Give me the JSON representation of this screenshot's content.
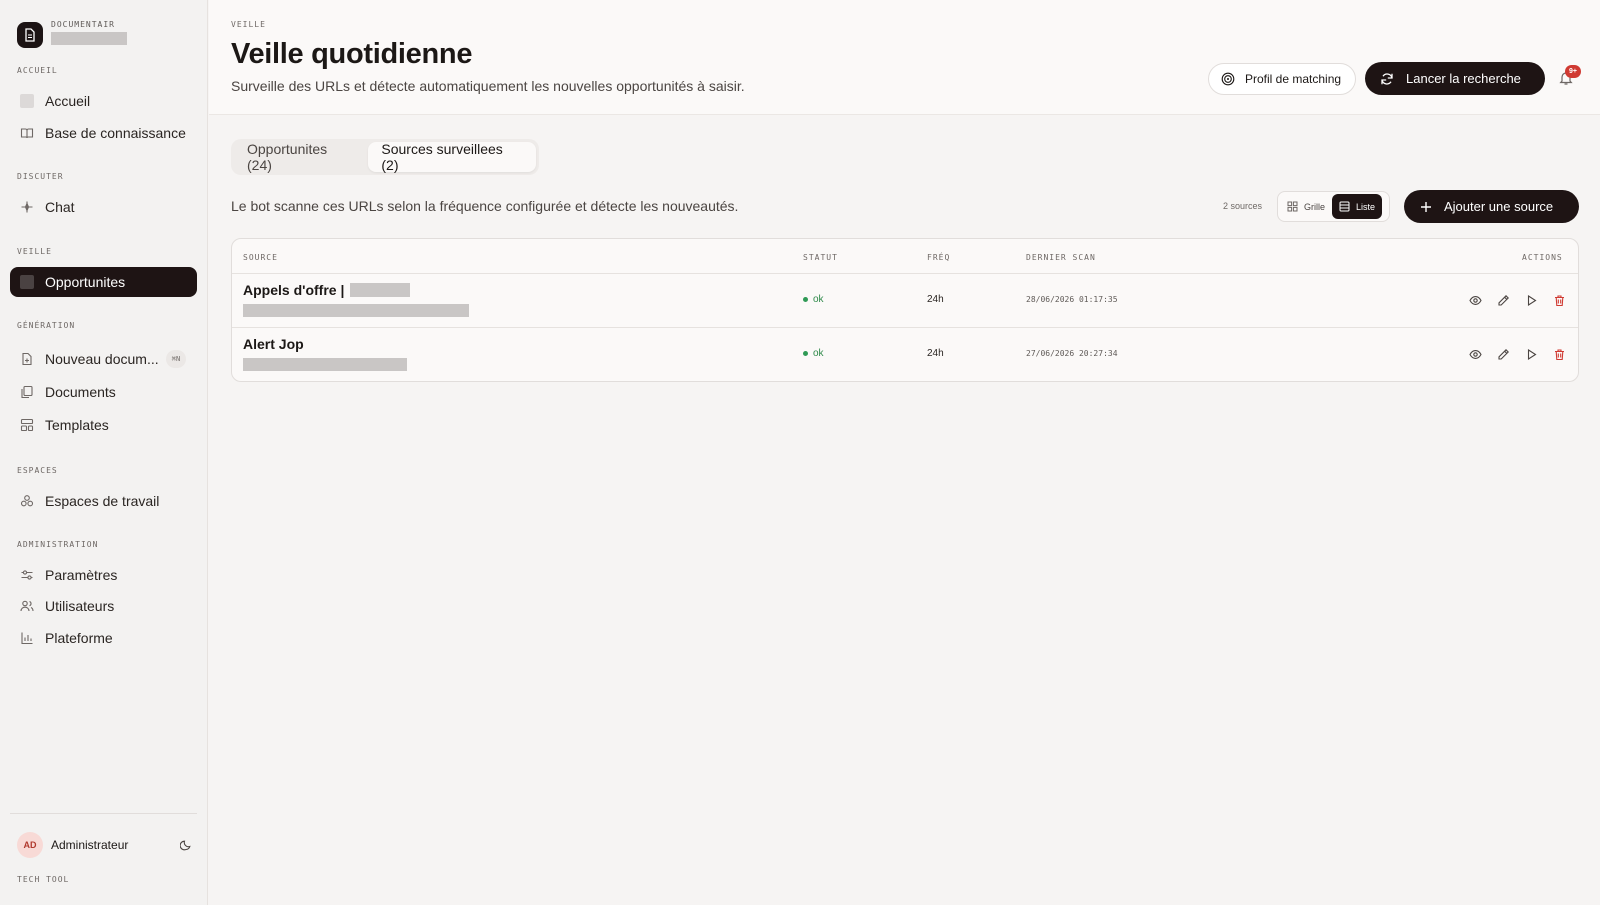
{
  "brand": {
    "name": "DOCUMENTAIR"
  },
  "sidebar": {
    "sections": {
      "accueil": "ACCUEIL",
      "discuter": "DISCUTER",
      "veille": "VEILLE",
      "generation": "GÉNÉRATION",
      "espaces": "ESPACES",
      "administration": "ADMINISTRATION"
    },
    "items": {
      "accueil": "Accueil",
      "knowledge": "Base de connaissance",
      "chat": "Chat",
      "opportunites": "Opportunites",
      "new_doc": "Nouveau docum...",
      "new_doc_badge": "⌘N",
      "documents": "Documents",
      "templates": "Templates",
      "workspaces": "Espaces de travail",
      "settings": "Paramètres",
      "users": "Utilisateurs",
      "platform": "Plateforme"
    },
    "user": {
      "initials": "AD",
      "name": "Administrateur"
    },
    "footer": "TECH TOOL"
  },
  "header": {
    "eyebrow": "VEILLE",
    "title": "Veille quotidienne",
    "subtitle": "Surveille des URLs et détecte automatiquement les nouvelles opportunités à saisir.",
    "profile_button": "Profil de matching",
    "run_button": "Lancer la recherche",
    "notif_count": "9+"
  },
  "tabs": [
    {
      "label": "Opportunites (24)",
      "active": false
    },
    {
      "label": "Sources surveillees (2)",
      "active": true
    }
  ],
  "sources": {
    "description": "Le bot scanne ces URLs selon la fréquence configurée et détecte les nouveautés.",
    "count": "2 sources",
    "view": {
      "grid": "Grille",
      "list": "Liste",
      "selected": "list"
    },
    "add_button": "Ajouter une source",
    "columns": {
      "source": "SOURCE",
      "status": "STATUT",
      "freq": "FRÉQ",
      "last_scan": "DERNIER SCAN",
      "actions": "ACTIONS"
    },
    "rows": [
      {
        "name": "Appels d'offre |",
        "status": "ok",
        "freq": "24h",
        "last_scan": "28/06/2026 01:17:35"
      },
      {
        "name": "Alert Jop",
        "status": "ok",
        "freq": "24h",
        "last_scan": "27/06/2026 20:27:34"
      }
    ]
  },
  "colors": {
    "accent_dark": "#1e1414",
    "status_ok": "#2f9a55",
    "danger": "#d03a32"
  },
  "icons": [
    "document-icon",
    "home-icon",
    "book-icon",
    "sparkle-icon",
    "file-plus-icon",
    "copy-icon",
    "layout-icon",
    "workspace-icon",
    "sliders-icon",
    "users-icon",
    "bar-chart-icon",
    "moon-icon",
    "target-icon",
    "refresh-icon",
    "bell-icon",
    "grid-icon",
    "list-icon",
    "plus-icon",
    "eye-icon",
    "pencil-icon",
    "play-icon",
    "trash-icon"
  ]
}
